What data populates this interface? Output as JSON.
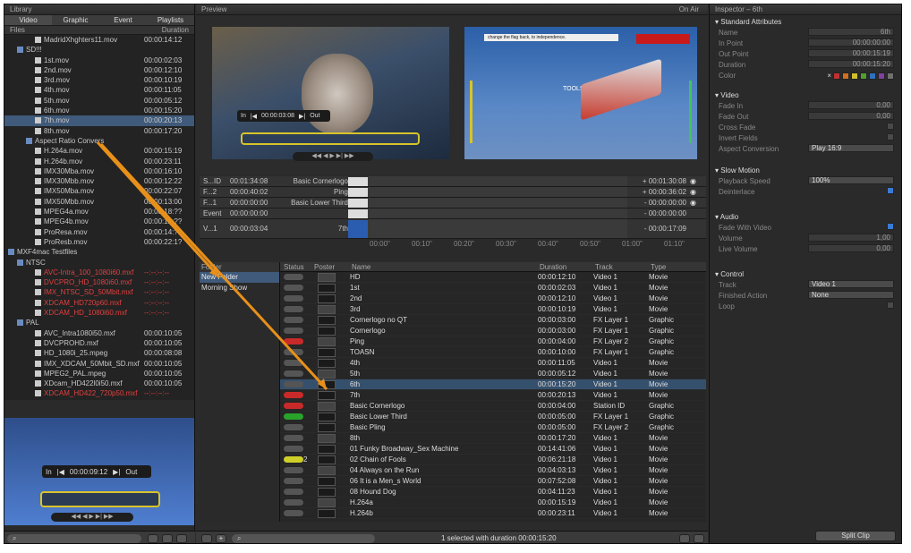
{
  "library": {
    "title": "Library",
    "tabs": [
      "Video",
      "Graphic",
      "Event",
      "Playlists"
    ],
    "col_files": "Files",
    "col_duration": "Duration",
    "items": [
      {
        "n": "MadridXhghters11.mov",
        "d": "00:00:14:12",
        "ind": 3,
        "t": "file"
      },
      {
        "n": "SD!!!",
        "d": "",
        "ind": 1,
        "t": "folder"
      },
      {
        "n": "1st.mov",
        "d": "00:00:02:03",
        "ind": 3,
        "t": "file"
      },
      {
        "n": "2nd.mov",
        "d": "00:00:12:10",
        "ind": 3,
        "t": "file"
      },
      {
        "n": "3rd.mov",
        "d": "00:00:10:19",
        "ind": 3,
        "t": "file"
      },
      {
        "n": "4th.mov",
        "d": "00:00:11:05",
        "ind": 3,
        "t": "file"
      },
      {
        "n": "5th.mov",
        "d": "00:00:05:12",
        "ind": 3,
        "t": "file"
      },
      {
        "n": "6th.mov",
        "d": "00:00:15:20",
        "ind": 3,
        "t": "file"
      },
      {
        "n": "7th.mov",
        "d": "00:00:20:13",
        "ind": 3,
        "t": "file",
        "sel": true
      },
      {
        "n": "8th.mov",
        "d": "00:00:17:20",
        "ind": 3,
        "t": "file"
      },
      {
        "n": "Aspect Ratio Convers",
        "d": "",
        "ind": 2,
        "t": "folder"
      },
      {
        "n": "H.264a.mov",
        "d": "00:00:15:19",
        "ind": 3,
        "t": "file"
      },
      {
        "n": "H.264b.mov",
        "d": "00:00:23:11",
        "ind": 3,
        "t": "file"
      },
      {
        "n": "IMX30Mba.mov",
        "d": "00:00:16:10",
        "ind": 3,
        "t": "file"
      },
      {
        "n": "IMX30Mbb.mov",
        "d": "00:00:12:22",
        "ind": 3,
        "t": "file"
      },
      {
        "n": "IMX50Mba.mov",
        "d": "00:00:22:07",
        "ind": 3,
        "t": "file"
      },
      {
        "n": "IMX50Mbb.mov",
        "d": "00:00:13:00",
        "ind": 3,
        "t": "file"
      },
      {
        "n": "MPEG4a.mov",
        "d": "00:00:18:??",
        "ind": 3,
        "t": "file"
      },
      {
        "n": "MPEG4b.mov",
        "d": "00:00:12:??",
        "ind": 3,
        "t": "file"
      },
      {
        "n": "ProResa.mov",
        "d": "00:00:14:??",
        "ind": 3,
        "t": "file"
      },
      {
        "n": "ProResb.mov",
        "d": "00:00:22:1?",
        "ind": 3,
        "t": "file"
      },
      {
        "n": "MXF4mac Testfiles",
        "d": "",
        "ind": 0,
        "t": "folder"
      },
      {
        "n": "NTSC",
        "d": "",
        "ind": 1,
        "t": "folder"
      },
      {
        "n": "AVC-Intra_100_1080i60.mxf",
        "d": "--:--:--:--",
        "ind": 3,
        "t": "file",
        "red": true
      },
      {
        "n": "DVCPRO_HD_1080i60.mxf",
        "d": "--:--:--:--",
        "ind": 3,
        "t": "file",
        "red": true
      },
      {
        "n": "IMX_NTSC_SD_50Mbit.mxf",
        "d": "--:--:--:--",
        "ind": 3,
        "t": "file",
        "red": true
      },
      {
        "n": "XDCAM_HD720p60.mxf",
        "d": "--:--:--:--",
        "ind": 3,
        "t": "file",
        "red": true
      },
      {
        "n": "XDCAM_HD_1080i60.mxf",
        "d": "--:--:--:--",
        "ind": 3,
        "t": "file",
        "red": true
      },
      {
        "n": "PAL",
        "d": "",
        "ind": 1,
        "t": "folder"
      },
      {
        "n": "AVC_Intra1080i50.mxf",
        "d": "00:00:10:05",
        "ind": 3,
        "t": "file"
      },
      {
        "n": "DVCPROHD.mxf",
        "d": "00:00:10:05",
        "ind": 3,
        "t": "file"
      },
      {
        "n": "HD_1080i_25.mpeg",
        "d": "00:00:08:08",
        "ind": 3,
        "t": "file"
      },
      {
        "n": "IMX_XDCAM_50Mbit_SD.mxf",
        "d": "00:00:10:05",
        "ind": 3,
        "t": "file"
      },
      {
        "n": "MPEG2_PAL.mpeg",
        "d": "00:00:10:05",
        "ind": 3,
        "t": "file"
      },
      {
        "n": "XDcam_HD422l0i50.mxf",
        "d": "00:00:10:05",
        "ind": 3,
        "t": "file"
      },
      {
        "n": "XDCAM_HD422_720p50.mxf",
        "d": "--:--:--:--",
        "ind": 3,
        "t": "file",
        "red": true
      }
    ],
    "player": {
      "in": "In",
      "tc": "00:00:09:12",
      "out": "Out"
    }
  },
  "preview": {
    "title": "Preview",
    "on_air": "On Air",
    "in": "In",
    "tc": "00:00:03:08",
    "out": "Out",
    "air_text": "TOOLS",
    "air_banner": "change the flag back, to independence."
  },
  "timeline": {
    "rows": [
      {
        "name": "S...ID",
        "tc": "00:01:34:08",
        "label": "Basic Cornerlogo",
        "right": "+ 00:01:30:08"
      },
      {
        "name": "F...2",
        "tc": "00:00:40:02",
        "label": "Ping",
        "right": "+ 00:00:36:02"
      },
      {
        "name": "F...1",
        "tc": "00:00:00:00",
        "label": "Basic Lower Third",
        "right": "- 00:00:00:00"
      },
      {
        "name": "Event",
        "tc": "00:00:00:00",
        "label": "",
        "right": "- 00:00:00:00"
      },
      {
        "name": "V...1",
        "tc": "00:00:03:04",
        "label": "7th",
        "right": "- 00:00:17:09"
      }
    ],
    "ruler": [
      "00:00\"",
      "00:10\"",
      "00:20\"",
      "00:30\"",
      "00:40\"",
      "00:50\"",
      "01:00\"",
      "01:10\""
    ]
  },
  "playlists": [
    "Folder",
    "New Folder",
    "Morning Show"
  ],
  "clips": {
    "headers": [
      "Status",
      "Poster",
      "Name",
      "Duration",
      "Track",
      "Type"
    ],
    "rows": [
      {
        "st": "",
        "n": "HD",
        "d": "00:00:12:10",
        "tr": "Video 1",
        "ty": "Movie"
      },
      {
        "st": "",
        "n": "1st",
        "d": "00:00:02:03",
        "tr": "Video 1",
        "ty": "Movie"
      },
      {
        "st": "",
        "n": "2nd",
        "d": "00:00:12:10",
        "tr": "Video 1",
        "ty": "Movie"
      },
      {
        "st": "",
        "n": "3rd",
        "d": "00:00:10:19",
        "tr": "Video 1",
        "ty": "Movie"
      },
      {
        "st": "",
        "n": "Cornerlogo no QT",
        "d": "00:00:03:00",
        "tr": "FX Layer 1",
        "ty": "Graphic"
      },
      {
        "st": "",
        "n": "Cornerlogo",
        "d": "00:00:03:00",
        "tr": "FX Layer 1",
        "ty": "Graphic"
      },
      {
        "st": "red",
        "n": "Ping",
        "d": "00:00:04:00",
        "tr": "FX Layer 2",
        "ty": "Graphic"
      },
      {
        "st": "",
        "n": "TOASN",
        "d": "00:00:10:00",
        "tr": "FX Layer 1",
        "ty": "Graphic"
      },
      {
        "st": "",
        "n": "4th",
        "d": "00:00:11:05",
        "tr": "Video 1",
        "ty": "Movie"
      },
      {
        "st": "",
        "n": "5th",
        "d": "00:00:05:12",
        "tr": "Video 1",
        "ty": "Movie"
      },
      {
        "st": "",
        "n": "6th",
        "d": "00:00:15:20",
        "tr": "Video 1",
        "ty": "Movie",
        "sel": true
      },
      {
        "st": "red",
        "n": "7th",
        "d": "00:00:20:13",
        "tr": "Video 1",
        "ty": "Movie"
      },
      {
        "st": "red",
        "n": "Basic Cornerlogo",
        "d": "00:00:04:00",
        "tr": "Station ID",
        "ty": "Graphic"
      },
      {
        "st": "green",
        "n": "Basic Lower Third",
        "d": "00:00:05:00",
        "tr": "FX Layer 1",
        "ty": "Graphic"
      },
      {
        "st": "",
        "n": "Basic Pling",
        "d": "00:00:05:00",
        "tr": "FX Layer 2",
        "ty": "Graphic"
      },
      {
        "st": "",
        "n": "8th",
        "d": "00:00:17:20",
        "tr": "Video 1",
        "ty": "Movie"
      },
      {
        "st": "",
        "n": "01 Funky Broadway_Sex Machine",
        "d": "00:14:41:06",
        "tr": "Video 1",
        "ty": "Movie"
      },
      {
        "st": "yellow",
        "n": "02 Chain of Fools",
        "d": "00:06:21:18",
        "tr": "Video 1",
        "ty": "Movie",
        "badge": "2"
      },
      {
        "st": "",
        "n": "04 Always on the Run",
        "d": "00:04:03:13",
        "tr": "Video 1",
        "ty": "Movie"
      },
      {
        "st": "",
        "n": "06 It is a Men_s World",
        "d": "00:07:52:08",
        "tr": "Video 1",
        "ty": "Movie"
      },
      {
        "st": "",
        "n": "08 Hound Dog",
        "d": "00:04:11:23",
        "tr": "Video 1",
        "ty": "Movie"
      },
      {
        "st": "",
        "n": "H.264a",
        "d": "00:00:15:19",
        "tr": "Video 1",
        "ty": "Movie"
      },
      {
        "st": "",
        "n": "H.264b",
        "d": "00:00:23:11",
        "tr": "Video 1",
        "ty": "Movie"
      }
    ]
  },
  "status": "1 selected with duration 00:00:15:20",
  "inspector": {
    "title": "Inspector – 6th",
    "sec1": "Standard Attributes",
    "name_l": "Name",
    "name_v": "6th",
    "in_l": "In Point",
    "in_v": "00:00:00:00",
    "out_l": "Out Point",
    "out_v": "00:00:15:19",
    "dur_l": "Duration",
    "dur_v": "00:00:15:20",
    "color_l": "Color",
    "colors": [
      "#c03030",
      "#d07020",
      "#d0c030",
      "#50a030",
      "#3070c0",
      "#8040a0",
      "#707070"
    ],
    "sec2": "Video",
    "fadein_l": "Fade In",
    "fadein_v": "0,00",
    "fadeout_l": "Fade Out",
    "fadeout_v": "0,00",
    "cross_l": "Cross Fade",
    "invert_l": "Invert Fields",
    "aspect_l": "Aspect Conversion",
    "aspect_v": "Play 16:9",
    "sec3": "Slow Motion",
    "speed_l": "Playback Speed",
    "speed_v": "100%",
    "deint_l": "Deinterlace",
    "sec4": "Audio",
    "fwv_l": "Fade With Video",
    "vol_l": "Volume",
    "vol_v": "1,00",
    "live_l": "Live Volume",
    "live_v": "0,00",
    "sec5": "Control",
    "track_l": "Track",
    "track_v": "Video 1",
    "fin_l": "Finished Action",
    "fin_v": "None",
    "loop_l": "Loop",
    "split": "Split Clip"
  }
}
